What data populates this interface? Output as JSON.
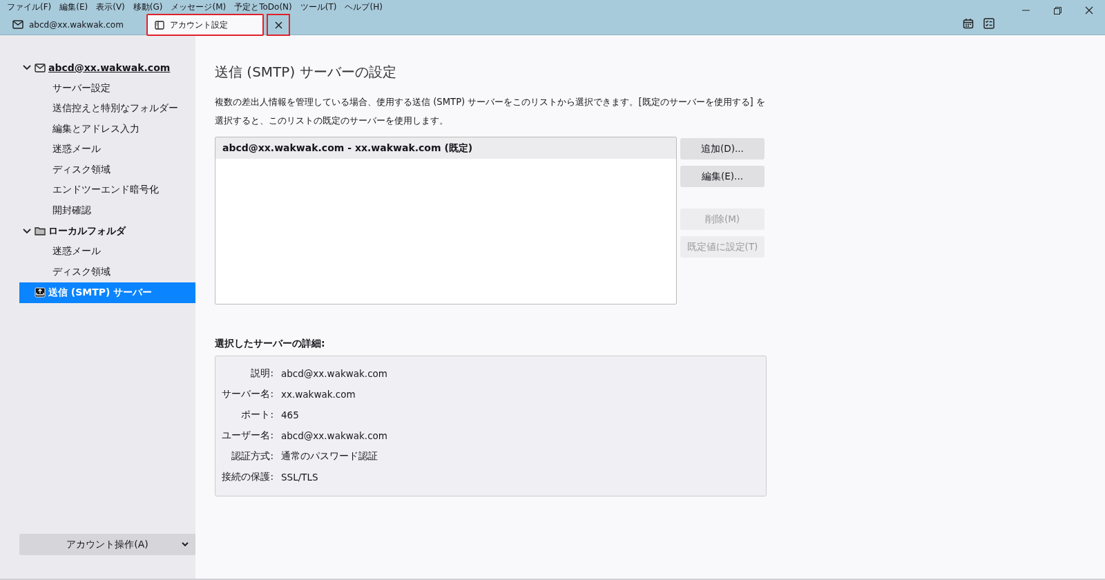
{
  "menu": [
    {
      "label": "ファイル(F)"
    },
    {
      "label": "編集(E)"
    },
    {
      "label": "表示(V)"
    },
    {
      "label": "移動(G)"
    },
    {
      "label": "メッセージ(M)"
    },
    {
      "label": "予定とToDo(N)"
    },
    {
      "label": "ツール(T)"
    },
    {
      "label": "ヘルプ(H)"
    }
  ],
  "tabs": [
    {
      "label": "abcd@xx.wakwak.com",
      "kind": "mail",
      "selected": false
    },
    {
      "label": "アカウント設定",
      "kind": "settings",
      "selected": true
    }
  ],
  "sidebar": {
    "tree": [
      {
        "label": "abcd@xx.wakwak.com",
        "kind": "account",
        "expanded": true,
        "selected": false,
        "children": [
          {
            "label": "サーバー設定",
            "selected": false
          },
          {
            "label": "送信控えと特別なフォルダー",
            "selected": false
          },
          {
            "label": "編集とアドレス入力",
            "selected": false
          },
          {
            "label": "迷惑メール",
            "selected": false
          },
          {
            "label": "ディスク領域",
            "selected": false
          },
          {
            "label": "エンドツーエンド暗号化",
            "selected": false
          },
          {
            "label": "開封確認",
            "selected": false
          }
        ]
      },
      {
        "label": "ローカルフォルダ",
        "kind": "folder",
        "expanded": true,
        "selected": false,
        "children": [
          {
            "label": "迷惑メール",
            "selected": false
          },
          {
            "label": "ディスク領域",
            "selected": false
          }
        ]
      },
      {
        "label": "送信 (SMTP) サーバー",
        "kind": "outbox",
        "selected": true
      }
    ],
    "account_actions": "アカウント操作(A)"
  },
  "page": {
    "title": "送信 (SMTP) サーバーの設定",
    "description": "複数の差出人情報を管理している場合、使用する送信 (SMTP) サーバーをこのリストから選択できます。[既定のサーバーを使用する] を選択すると、このリストの既定のサーバーを使用します。",
    "servers": [
      {
        "label": "abcd@xx.wakwak.com - xx.wakwak.com (既定)",
        "selected": true
      }
    ],
    "buttons": [
      {
        "label": "追加(D)...",
        "disabled": false
      },
      {
        "label": "編集(E)...",
        "disabled": false
      },
      {
        "label": "削除(M)",
        "disabled": true
      },
      {
        "label": "既定値に設定(T)",
        "disabled": true
      }
    ],
    "details_title": "選択したサーバーの詳細:",
    "details": [
      {
        "label": "説明:",
        "value": "abcd@xx.wakwak.com"
      },
      {
        "label": "サーバー名:",
        "value": "xx.wakwak.com"
      },
      {
        "label": "ポート:",
        "value": "465"
      },
      {
        "label": "ユーザー名:",
        "value": "abcd@xx.wakwak.com"
      },
      {
        "label": "認証方式:",
        "value": "通常のパスワード認証"
      },
      {
        "label": "接続の保護:",
        "value": "SSL/TLS"
      }
    ]
  }
}
